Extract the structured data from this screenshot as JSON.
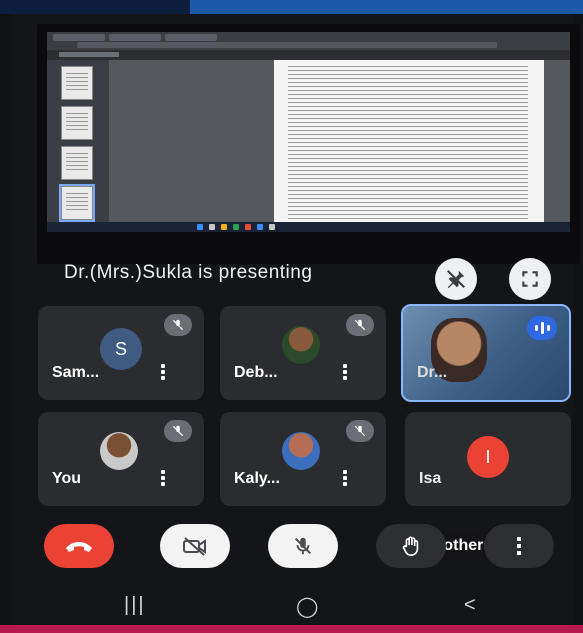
{
  "presenting": {
    "text": "Dr.(Mrs.)Sukla is presenting"
  },
  "participants": [
    {
      "name": "Sam...",
      "initial": "S",
      "avatar_color": "#3f5b82",
      "muted": true,
      "has_photo": false
    },
    {
      "name": "Deb...",
      "muted": true,
      "has_photo": true
    },
    {
      "name": "Dr...",
      "muted": false,
      "speaking": true,
      "has_photo": true
    },
    {
      "name": "You",
      "muted": true,
      "has_photo": true
    },
    {
      "name": "Kaly...",
      "muted": true,
      "has_photo": true
    },
    {
      "name": "Isa",
      "initial": "I",
      "avatar_color": "#ea4335",
      "muted": false,
      "has_photo": false
    }
  ],
  "others": {
    "label": "8 others"
  },
  "controls": {
    "end_call": "call-end-icon",
    "camera": "camera-off-icon",
    "mic": "mic-off-icon",
    "raise_hand": "raise-hand-icon",
    "more": "more-options-icon"
  },
  "colors": {
    "end_call": "#ea4335",
    "accent": "#2f66e2",
    "tile_bg": "#2a2c30"
  },
  "nav": {
    "recents": "|||",
    "home": "◯",
    "back": "<"
  }
}
